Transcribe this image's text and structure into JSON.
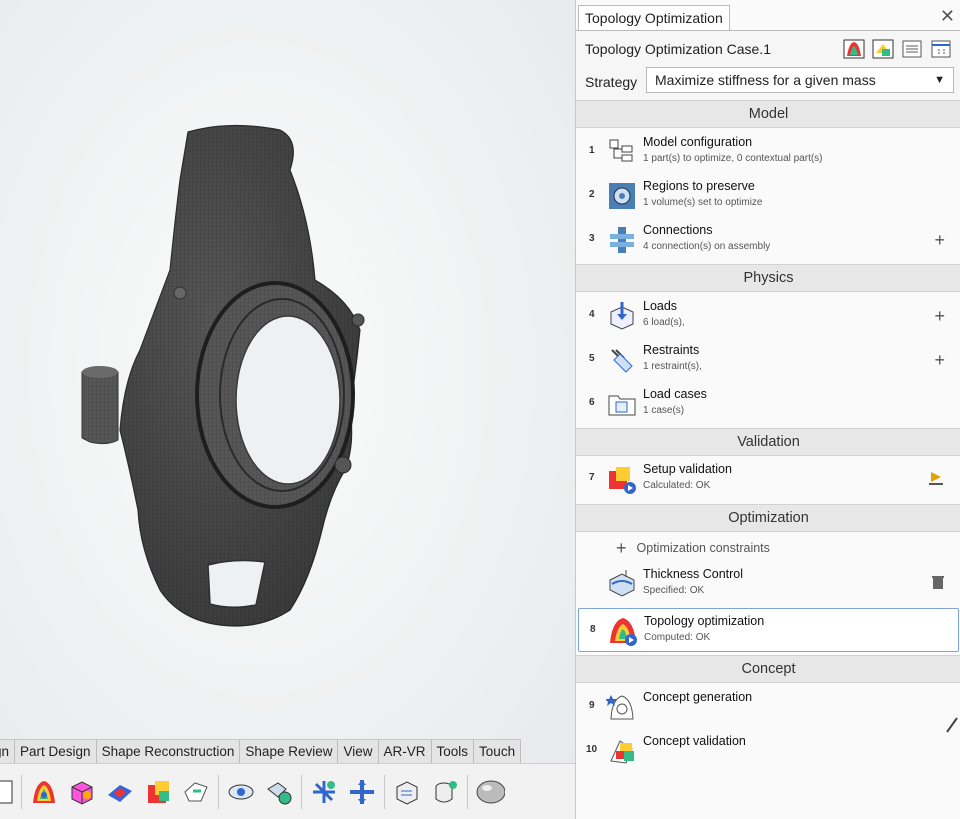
{
  "workbench_tabs": [
    "gn",
    "Part Design",
    "Shape Reconstruction",
    "Shape Review",
    "View",
    "AR-VR",
    "Tools",
    "Touch"
  ],
  "toolbar_icons": [
    "part-icon",
    "topology-map-icon",
    "mesh-box-icon",
    "color-map-icon",
    "color-cube-icon",
    "flow-icon",
    "eye-rotate-icon",
    "gear-part-icon",
    "arrow-fan-icon",
    "arrow-cross-icon",
    "drawing-icon",
    "cylinder-icon",
    "sphere-icon"
  ],
  "panel": {
    "tab_title": "Topology Optimization",
    "close": "✕",
    "case_title": "Topology Optimization Case.1",
    "strategy_label": "Strategy",
    "strategy_value": "Maximize stiffness for a given mass",
    "sections": {
      "model": "Model",
      "physics": "Physics",
      "validation": "Validation",
      "optimization": "Optimization",
      "concept": "Concept"
    },
    "rows": [
      {
        "num": "1",
        "title": "Model configuration",
        "sub": "1 part(s) to optimize, 0 contextual part(s)",
        "action": ""
      },
      {
        "num": "2",
        "title": "Regions to preserve",
        "sub": "1 volume(s) set to optimize",
        "action": ""
      },
      {
        "num": "3",
        "title": "Connections",
        "sub": "4 connection(s) on assembly",
        "action": "+"
      },
      {
        "num": "4",
        "title": "Loads",
        "sub": "6 load(s),",
        "action": "+"
      },
      {
        "num": "5",
        "title": "Restraints",
        "sub": "1 restraint(s),",
        "action": "+"
      },
      {
        "num": "6",
        "title": "Load cases",
        "sub": "1 case(s)",
        "action": ""
      },
      {
        "num": "7",
        "title": "Setup validation",
        "sub": "Calculated: OK",
        "action": ""
      },
      {
        "num": "",
        "title": "Thickness Control",
        "sub": "Specified: OK",
        "action": ""
      },
      {
        "num": "8",
        "title": "Topology optimization",
        "sub": "Computed: OK",
        "action": ""
      },
      {
        "num": "9",
        "title": "Concept generation",
        "sub": "",
        "action": ""
      },
      {
        "num": "10",
        "title": "Concept validation",
        "sub": "",
        "action": ""
      }
    ],
    "optimization_constraints": "Optimization constraints",
    "plus": "+"
  },
  "colors": {
    "accent": "#7ea5d6",
    "section_bg": "#e7e7e7",
    "model": "#4a4a4a"
  }
}
